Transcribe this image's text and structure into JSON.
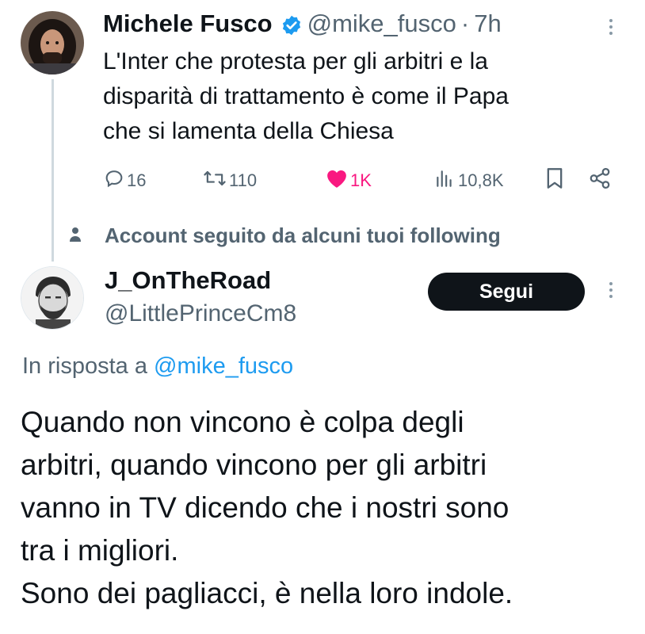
{
  "tweet1": {
    "author_name": "Michele Fusco",
    "handle": "@mike_fusco",
    "separator": "·",
    "time": "7h",
    "text_lines": [
      "L'Inter che protesta per gli arbitri e la",
      "disparità di trattamento è come il Papa",
      "che si lamenta della Chiesa"
    ],
    "replies": "16",
    "retweets": "110",
    "likes": "1K",
    "views": "10,8K"
  },
  "social_context": "Account seguito da alcuni tuoi following",
  "tweet2": {
    "author_name": "J_OnTheRoad",
    "handle": "@LittlePrinceCm8",
    "follow_label": "Segui",
    "reply_prefix": "In risposta a",
    "reply_mention": "@mike_fusco",
    "text_lines": [
      "Quando non vincono è colpa degli",
      "arbitri, quando vincono per gli arbitri",
      "vanno in TV dicendo che i nostri sono",
      "tra i migliori.",
      "Sono dei pagliacci, è nella loro indole."
    ]
  },
  "icons": {
    "verified": "verified-badge-icon",
    "reply": "reply-icon",
    "retweet": "retweet-icon",
    "like": "heart-icon",
    "views": "views-icon",
    "bookmark": "bookmark-icon",
    "share": "share-icon",
    "more": "more-vertical-icon",
    "person": "person-icon"
  },
  "colors": {
    "text": "#0f1419",
    "secondary": "#536471",
    "link": "#1d9bf0",
    "like": "#f91880",
    "button_bg": "#0f1419",
    "button_text": "#ffffff"
  }
}
